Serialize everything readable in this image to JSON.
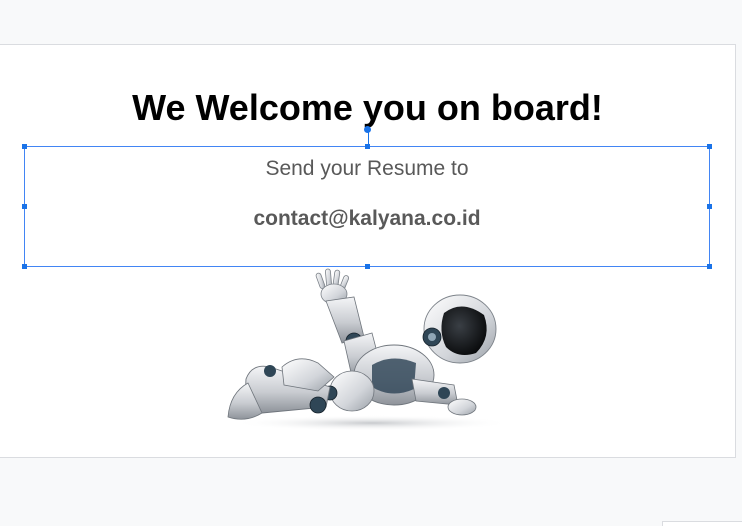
{
  "slide": {
    "title": "We Welcome you on board!",
    "textbox": {
      "line1": "Send your Resume to",
      "line2": "contact@kalyana.co.id"
    },
    "image": {
      "icon": "robot-illustration"
    }
  },
  "colors": {
    "selection": "#4285f4",
    "handle": "#1a73e8",
    "title_text": "#000000",
    "body_text": "#595959",
    "canvas_bg": "#f8f9fa",
    "slide_bg": "#ffffff"
  }
}
